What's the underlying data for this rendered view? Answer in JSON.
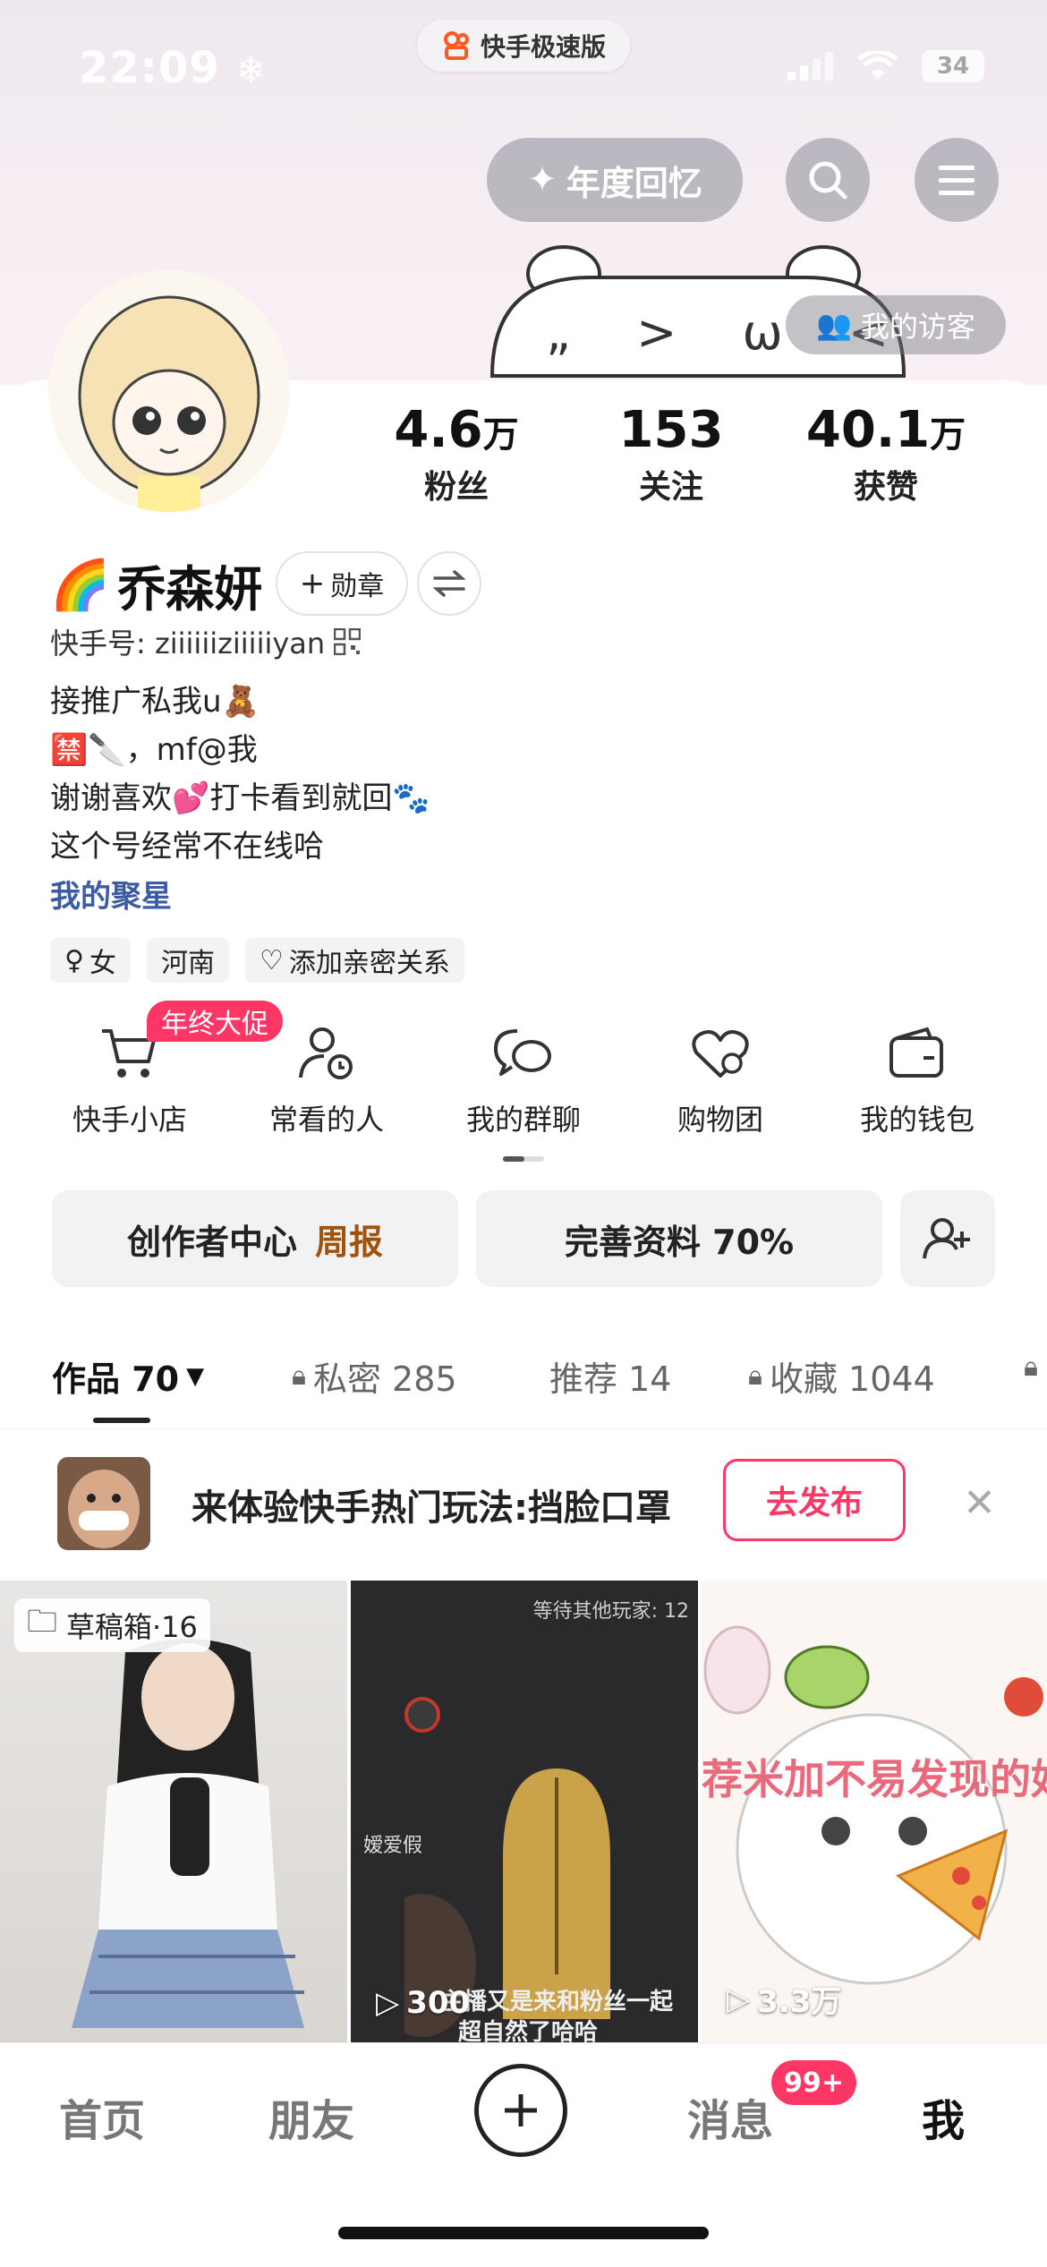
{
  "status_bar": {
    "time": "22:09",
    "pill_label": "快手极速版",
    "battery": "34"
  },
  "header": {
    "year_button": "年度回忆",
    "visitor_button": "我的访客"
  },
  "hero_text": "„ > ω <",
  "stats": [
    {
      "value": "4.6",
      "unit": "万",
      "label": "粉丝"
    },
    {
      "value": "153",
      "unit": "",
      "label": "关注"
    },
    {
      "value": "40.1",
      "unit": "万",
      "label": "获赞"
    }
  ],
  "profile": {
    "name": "乔森妍",
    "name_emoji": "🌈",
    "badge_button": "勋章",
    "kuaishou_id": "快手号: ziiiiiiziiiiiyan",
    "bio": [
      "接推广私我u🧸",
      "🈲🔪，mf@我",
      "谢谢喜欢💕打卡看到就回🐾",
      "这个号经常不在线哈"
    ],
    "link": "我的聚星",
    "tags": {
      "gender": "女",
      "region": "河南",
      "relation": "添加亲密关系"
    }
  },
  "shortcuts": [
    {
      "label": "快手小店",
      "icon": "cart-icon"
    },
    {
      "label": "常看的人",
      "icon": "person-clock-icon"
    },
    {
      "label": "我的群聊",
      "icon": "chat-bubbles-icon"
    },
    {
      "label": "购物团",
      "icon": "heart-bag-icon"
    },
    {
      "label": "我的钱包",
      "icon": "wallet-icon"
    }
  ],
  "promo_badge": "年终大促",
  "actions": {
    "creator_center": "创作者中心",
    "creator_weekly": "周报",
    "complete_profile": "完善资料 70%"
  },
  "tabs": [
    {
      "label": "作品 70",
      "active": true
    },
    {
      "label": "私密 285",
      "active": false
    },
    {
      "label": "推荐 14",
      "active": false
    },
    {
      "label": "收藏 1044",
      "active": false
    }
  ],
  "banner": {
    "text": "来体验快手热门玩法:挡脸口罩",
    "button": "去发布"
  },
  "grid": [
    {
      "overlay": "草稿箱·16",
      "plays": ""
    },
    {
      "overlay": "等待其他玩家: 12",
      "plays": "300",
      "caption": "主播又是来和粉丝一起",
      "caption2": "超自然了哈哈",
      "name_tag": "嫒爱假"
    },
    {
      "overlay": "荐米加不易发现的好",
      "plays": "3.3万"
    }
  ],
  "bottom_nav": {
    "home": "首页",
    "friends": "朋友",
    "messages": "消息",
    "messages_badge": "99+",
    "me": "我"
  },
  "colors": {
    "accent": "#fe3666",
    "weekly": "#a0520a",
    "link": "#3b5ba5"
  }
}
